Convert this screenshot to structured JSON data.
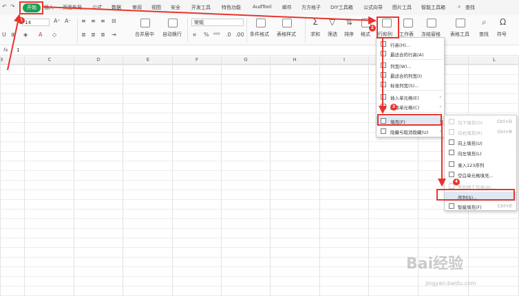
{
  "menubar": {
    "tabs": [
      "开始",
      "插入",
      "页面布局",
      "公式",
      "数据",
      "审阅",
      "视图",
      "安全",
      "开发工具",
      "特色功能",
      "AudTool",
      "邮件",
      "方方格子",
      "DIY工具箱",
      "公式向导",
      "图片工具",
      "智能工具箱"
    ],
    "search": "查找"
  },
  "ribbon": {
    "font_size": "14",
    "number_format": "常规",
    "merge_center": "合并居中",
    "auto_wrap": "自动换行",
    "cond_format": "条件格式",
    "table_style": "表格样式",
    "sum": "求和",
    "filter": "筛选",
    "sort": "排序",
    "format": "格式",
    "row_col": "行和列",
    "worksheet": "工作表",
    "freeze": "冻结窗格",
    "table_tools": "表格工具",
    "find": "查找",
    "symbol": "符号"
  },
  "formula_bar": {
    "fx": "fx",
    "value": "1"
  },
  "columns": [
    "B",
    "C",
    "D",
    "E",
    "F",
    "G",
    "H",
    "I",
    "J",
    "K",
    "L"
  ],
  "menu1": {
    "items": [
      {
        "label": "行高(H)...",
        "arrow": ""
      },
      {
        "label": "最适合的行高(A)",
        "arrow": ""
      },
      {
        "label": "列宽(W)...",
        "arrow": ""
      },
      {
        "label": "最适合的列宽(I)",
        "arrow": ""
      },
      {
        "label": "标准列宽(S)...",
        "arrow": ""
      },
      {
        "label": "插入单元格(E)",
        "arrow": "›"
      },
      {
        "label": "删除单元格(C)",
        "arrow": "›"
      },
      {
        "label": "填充(F)",
        "arrow": "›"
      },
      {
        "label": "隐藏与取消隐藏(U)",
        "arrow": "›"
      }
    ]
  },
  "menu2": {
    "items": [
      {
        "label": "向下填充(D)",
        "shortcut": "Ctrl+D"
      },
      {
        "label": "向右填充(R)",
        "shortcut": "Ctrl+R"
      },
      {
        "label": "向上填充(U)",
        "shortcut": ""
      },
      {
        "label": "向左填充(L)",
        "shortcut": ""
      },
      {
        "label": "录入123序列",
        "shortcut": ""
      },
      {
        "label": "空白单元格填充...",
        "shortcut": ""
      },
      {
        "label": "至同组工作表(A)...",
        "shortcut": ""
      },
      {
        "label": "序列(S)...",
        "shortcut": ""
      },
      {
        "label": "智能填充(F)",
        "shortcut": "Ctrl+E"
      }
    ]
  },
  "badges": [
    "1",
    "2",
    "3",
    "4"
  ],
  "watermark": {
    "text": "Bai经验",
    "sub": "jingyan.baidu.com"
  },
  "colors": {
    "accent": "#1f9d55",
    "highlight": "#e8332b"
  }
}
